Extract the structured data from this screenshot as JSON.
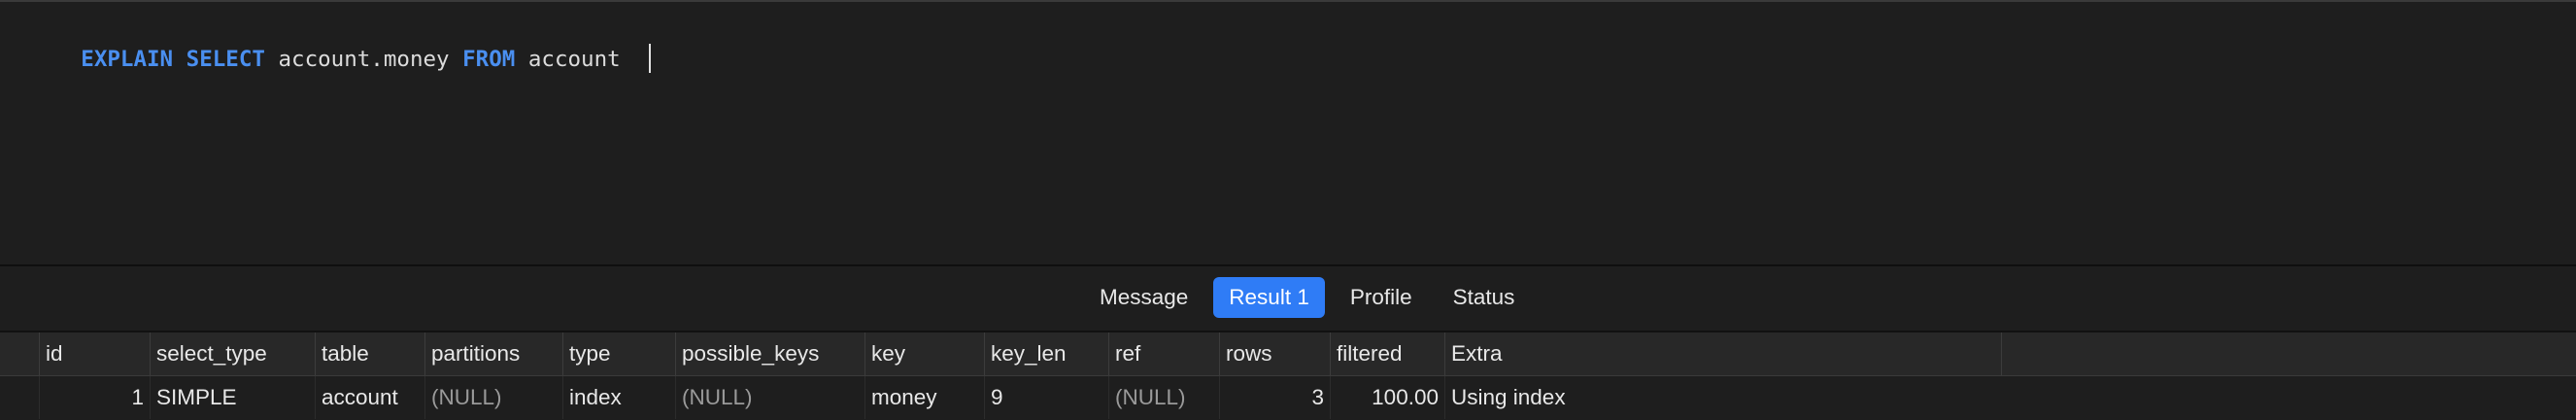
{
  "editor": {
    "query": [
      {
        "text": "EXPLAIN",
        "type": "keyword"
      },
      {
        "text": " ",
        "type": "plain"
      },
      {
        "text": "SELECT",
        "type": "keyword"
      },
      {
        "text": " account.money ",
        "type": "plain"
      },
      {
        "text": "FROM",
        "type": "keyword"
      },
      {
        "text": " account ",
        "type": "plain"
      }
    ]
  },
  "tabs": [
    {
      "label": "Message",
      "active": false
    },
    {
      "label": "Result 1",
      "active": true
    },
    {
      "label": "Profile",
      "active": false
    },
    {
      "label": "Status",
      "active": false
    }
  ],
  "grid": {
    "columns": [
      "id",
      "select_type",
      "table",
      "partitions",
      "type",
      "possible_keys",
      "key",
      "key_len",
      "ref",
      "rows",
      "filtered",
      "Extra"
    ],
    "rows": [
      [
        "1",
        "SIMPLE",
        "account",
        "(NULL)",
        "index",
        "(NULL)",
        "money",
        "9",
        "(NULL)",
        "3",
        "100.00",
        "Using index"
      ]
    ],
    "numeric_columns": [
      "id",
      "rows",
      "filtered"
    ]
  },
  "colors": {
    "background": "#1e1e1e",
    "keyword": "#4a8ff0",
    "active_tab": "#2f7cf6",
    "null_text": "#9a9a9a"
  }
}
